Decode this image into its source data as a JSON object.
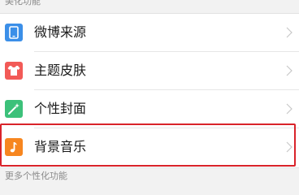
{
  "sections": {
    "top_label": "美化功能",
    "bottom_label": "更多个性化功能"
  },
  "items": [
    {
      "label": "微博来源",
      "icon": "phone-icon",
      "color": "#3b8fe8"
    },
    {
      "label": "主题皮肤",
      "icon": "tshirt-icon",
      "color": "#f25a57"
    },
    {
      "label": "个性封面",
      "icon": "magic-wand-icon",
      "color": "#3cc17a"
    },
    {
      "label": "背景音乐",
      "icon": "music-note-icon",
      "color": "#f7861f"
    }
  ],
  "colors": {
    "highlight": "#d9232a",
    "background": "#f2f2f2",
    "chevron": "#c8c8c8"
  }
}
